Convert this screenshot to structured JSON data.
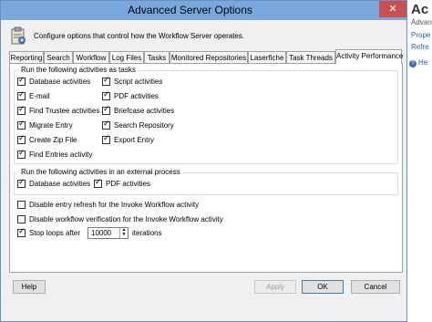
{
  "dialog": {
    "title": "Advanced Server Options",
    "close_glyph": "✕",
    "header_text": "Configure options that control how the Workflow Server operates.",
    "header_icon": "clipboard-settings-icon"
  },
  "tabs": [
    "Reporting",
    "Search",
    "Workflow",
    "Log Files",
    "Tasks",
    "Monitored Repositories",
    "Laserfiche",
    "Task Threads",
    "Activity Performance"
  ],
  "active_tab": "Activity Performance",
  "tasks_group": {
    "title": "Run the following activities as tasks",
    "left": [
      {
        "label": "Database activities",
        "checked": true
      },
      {
        "label": "E-mail",
        "checked": true
      },
      {
        "label": "Find Trustee activities",
        "checked": true
      },
      {
        "label": "Migrate Entry",
        "checked": true
      },
      {
        "label": "Create Zip File",
        "checked": true
      },
      {
        "label": "Find Entries activity",
        "checked": true
      }
    ],
    "right": [
      {
        "label": "Script activities",
        "checked": true
      },
      {
        "label": "PDF activities",
        "checked": true
      },
      {
        "label": "Briefcase activities",
        "checked": true
      },
      {
        "label": "Search Repository",
        "checked": true
      },
      {
        "label": "Export Entry",
        "checked": true
      }
    ]
  },
  "external_group": {
    "title": "Run the following activities in an external process",
    "items": [
      {
        "label": "Database activities",
        "checked": true
      },
      {
        "label": "PDF activities",
        "checked": true
      }
    ]
  },
  "options": {
    "disable_entry_refresh": {
      "label": "Disable entry refresh for the Invoke Workflow activity",
      "checked": false
    },
    "disable_workflow_verification": {
      "label": "Disable workflow verification for the Invoke Workflow activity",
      "checked": false
    },
    "stop_loops": {
      "label": "Stop loops after",
      "checked": true,
      "value": "10000",
      "suffix": "iterations"
    }
  },
  "buttons": {
    "help": "Help",
    "apply": "Apply",
    "ok": "OK",
    "cancel": "Cancel"
  },
  "background_window": {
    "title": "Ac",
    "subtitle": "Advan",
    "link1": "Prope",
    "link2": "Refre",
    "help": "He"
  },
  "colors": {
    "titlebar": "#7aa7dc",
    "close": "#c75050",
    "desktop": "#4a86c8"
  }
}
